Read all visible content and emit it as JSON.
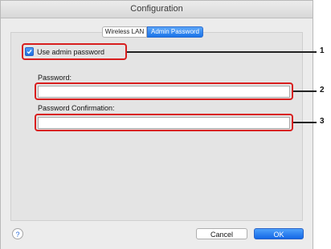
{
  "window": {
    "title": "Configuration"
  },
  "tabs": [
    {
      "label": "Wireless LAN",
      "active": false
    },
    {
      "label": "Admin Password",
      "active": true
    }
  ],
  "admin": {
    "use_admin_password_label": "Use admin password",
    "use_admin_password_checked": true
  },
  "password": {
    "label": "Password:",
    "value": ""
  },
  "password_confirmation": {
    "label": "Password Confirmation:",
    "value": ""
  },
  "callouts": {
    "one": "1",
    "two": "2",
    "three": "3"
  },
  "footer": {
    "help_label": "?",
    "cancel_label": "Cancel",
    "ok_label": "OK"
  },
  "colors": {
    "accent": "#1a73e8",
    "callout": "#d81e1e",
    "background": "#ececec"
  }
}
